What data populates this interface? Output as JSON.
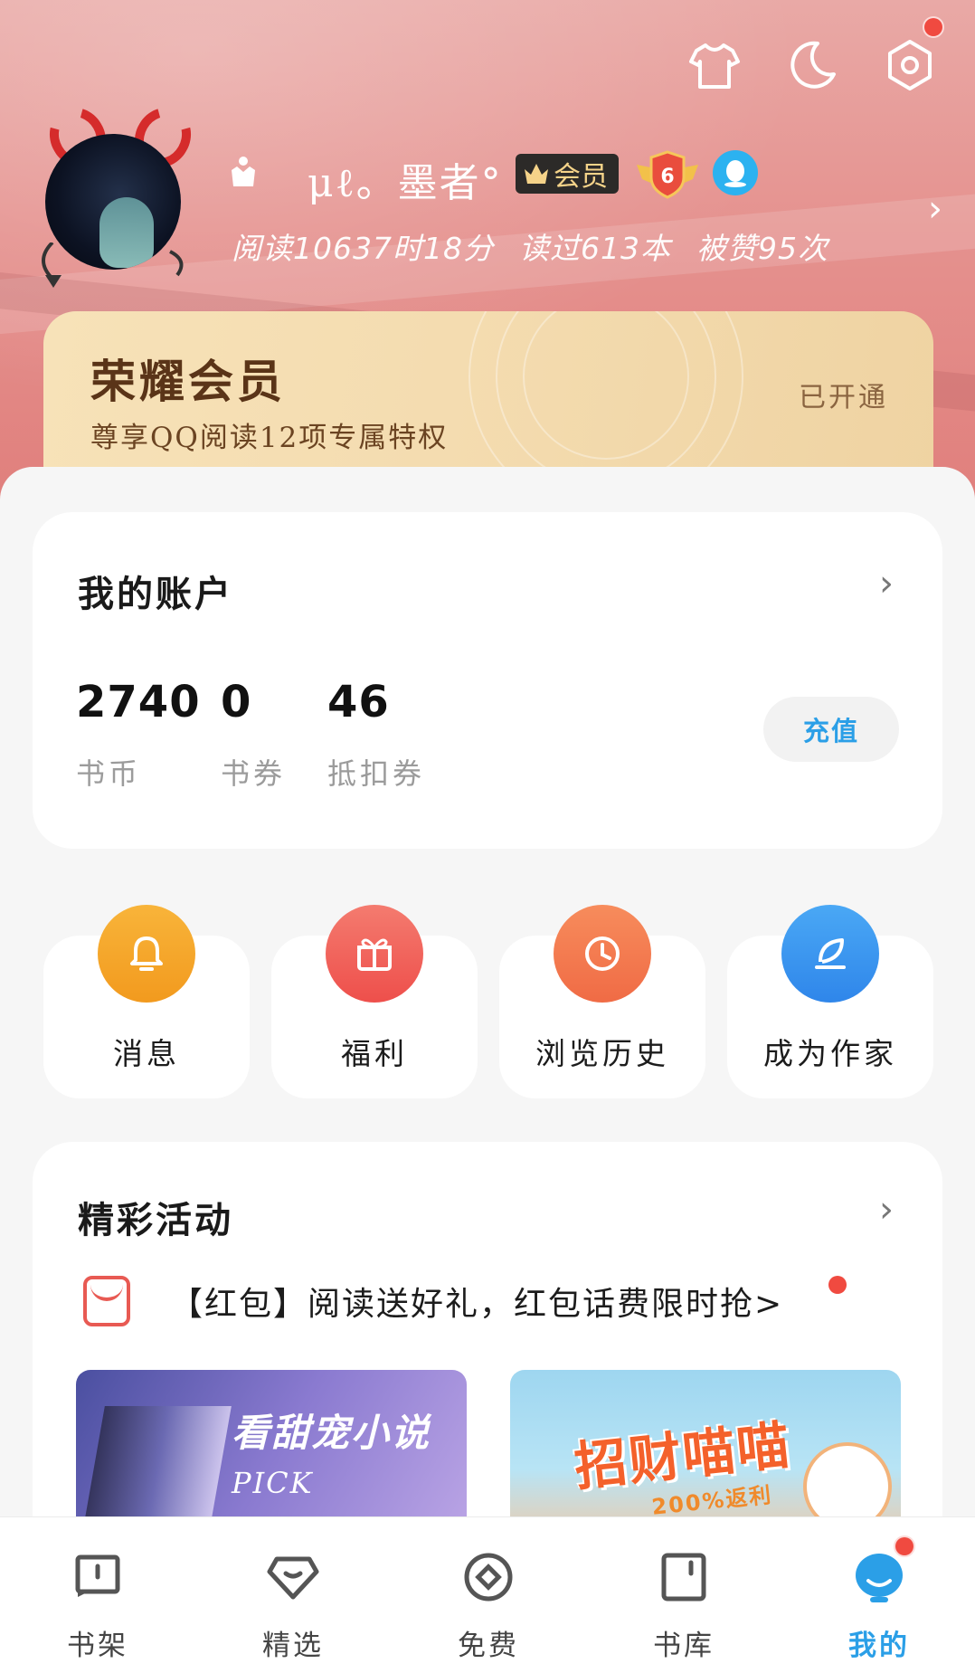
{
  "header": {
    "icons": [
      "shirt-icon",
      "moon-icon",
      "settings-icon"
    ],
    "settings_has_notification": true
  },
  "profile": {
    "name": "μℓ。墨者°",
    "member_badge": "会员",
    "level": "6",
    "stats": {
      "read_time": "阅读10637时18分",
      "books_read": "读过613本",
      "likes": "被赞95次"
    }
  },
  "vip_card": {
    "title": "荣耀会员",
    "subtitle": "尊享QQ阅读12项专属特权",
    "status": "已开通"
  },
  "account": {
    "title": "我的账户",
    "items": [
      {
        "value": "2740",
        "label": "书币"
      },
      {
        "value": "0",
        "label": "书券"
      },
      {
        "value": "46",
        "label": "抵扣券"
      }
    ],
    "recharge_label": "充值"
  },
  "shortcuts": [
    {
      "label": "消息",
      "icon": "bell-icon",
      "color": "#f5a623"
    },
    {
      "label": "福利",
      "icon": "gift-icon",
      "color": "#f0605a"
    },
    {
      "label": "浏览历史",
      "icon": "clock-icon",
      "color": "#f07a50"
    },
    {
      "label": "成为作家",
      "icon": "feather-icon",
      "color": "#3a95ee"
    }
  ],
  "activities": {
    "title": "精彩活动",
    "promo_text": "【红包】阅读送好礼，红包话费限时抢>",
    "banners": [
      {
        "text": "看甜宠小说",
        "text2": "PICK"
      },
      {
        "text": "招财喵喵",
        "text2": "200%返利"
      }
    ]
  },
  "tabbar": {
    "tabs": [
      {
        "label": "书架",
        "icon": "bookshelf-icon"
      },
      {
        "label": "精选",
        "icon": "featured-icon"
      },
      {
        "label": "免费",
        "icon": "free-icon"
      },
      {
        "label": "书库",
        "icon": "library-icon"
      },
      {
        "label": "我的",
        "icon": "me-icon",
        "active": true
      }
    ]
  },
  "colors": {
    "accent": "#2b9fe7",
    "notification": "#f04a40",
    "vip_text": "#5a3418"
  }
}
